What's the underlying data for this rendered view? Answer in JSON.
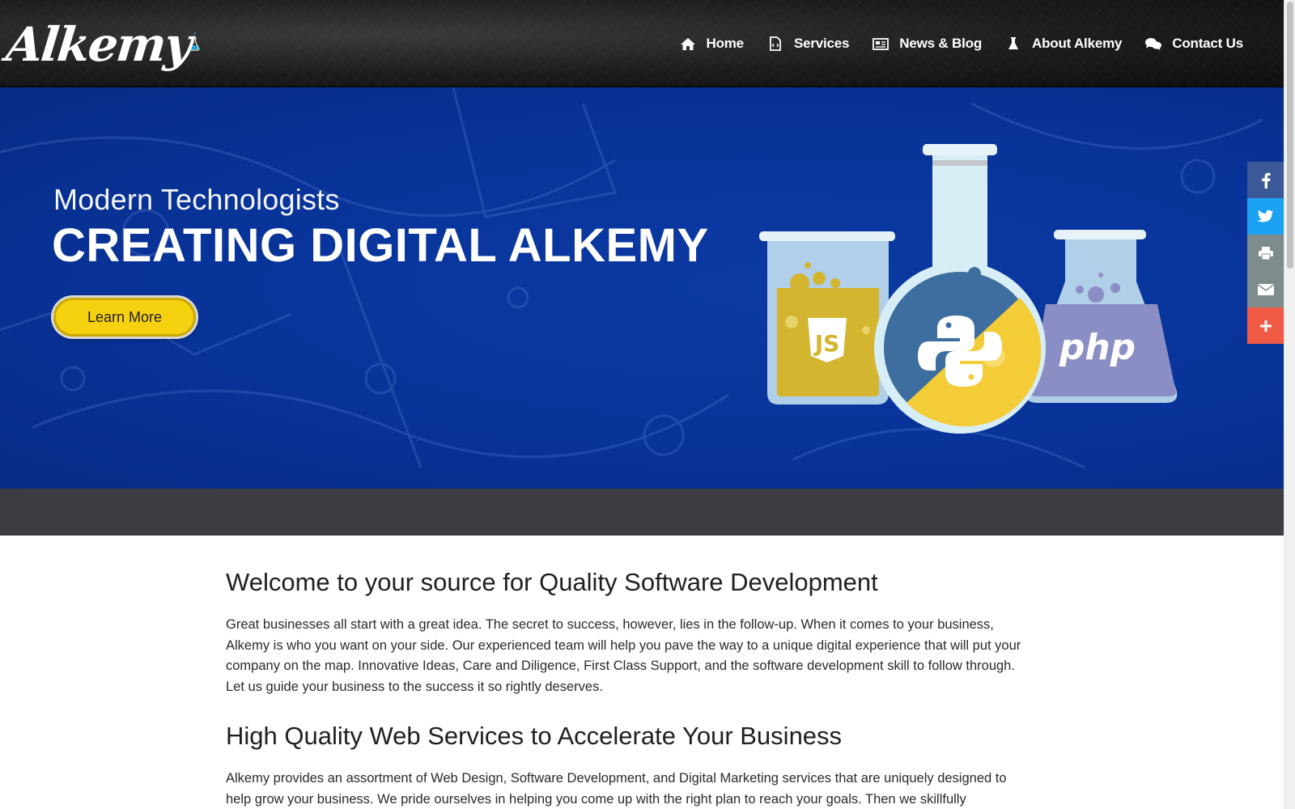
{
  "brand": {
    "name": "Alkemy",
    "flask_color": "#29b6e8"
  },
  "nav": {
    "items": [
      {
        "label": "Home",
        "icon": "home-icon"
      },
      {
        "label": "Services",
        "icon": "code-file-icon"
      },
      {
        "label": "News & Blog",
        "icon": "newspaper-icon"
      },
      {
        "label": "About Alkemy",
        "icon": "flask-icon"
      },
      {
        "label": "Contact Us",
        "icon": "chat-bubbles-icon"
      }
    ]
  },
  "hero": {
    "subtitle": "Modern Technologists",
    "title": "CREATING DIGITAL ALKEMY",
    "cta_label": "Learn More",
    "background_color": "#08349a",
    "cta_color": "#f6d10f",
    "illustration": {
      "left_flask_label": "JS",
      "right_flask_label": "php",
      "center_icon": "python-logo-icon"
    }
  },
  "social": {
    "buttons": [
      {
        "name": "facebook-button",
        "icon": "facebook-icon",
        "color": "#3b5998"
      },
      {
        "name": "twitter-button",
        "icon": "twitter-icon",
        "color": "#1da1f2"
      },
      {
        "name": "print-button",
        "icon": "print-icon",
        "color": "#7f8c8d"
      },
      {
        "name": "email-button",
        "icon": "email-icon",
        "color": "#7f8c8d"
      },
      {
        "name": "more-button",
        "icon": "plus-icon",
        "color": "#f05a44"
      }
    ]
  },
  "content": {
    "welcome_heading": "Welcome to your source for Quality Software Development",
    "welcome_lines": [
      "Great businesses all start with a great idea. The secret to success, however, lies in the follow-up. When it comes to your business,",
      "Alkemy is who you want on your side. Our experienced team will help you pave the way to a unique digital experience that will put your",
      "company on the map. Innovative Ideas, Care and Diligence, First Class Support, and the software development skill to follow through.",
      "Let us guide your business to the success it so rightly deserves."
    ],
    "services_heading": "High Quality Web Services to Accelerate Your Business",
    "services_lines": [
      "Alkemy provides an assortment of Web Design, Software Development, and Digital Marketing services that are uniquely designed to",
      "help grow your business. We pride ourselves in helping you come up with the right plan to reach your goals. Then we skillfully"
    ]
  }
}
